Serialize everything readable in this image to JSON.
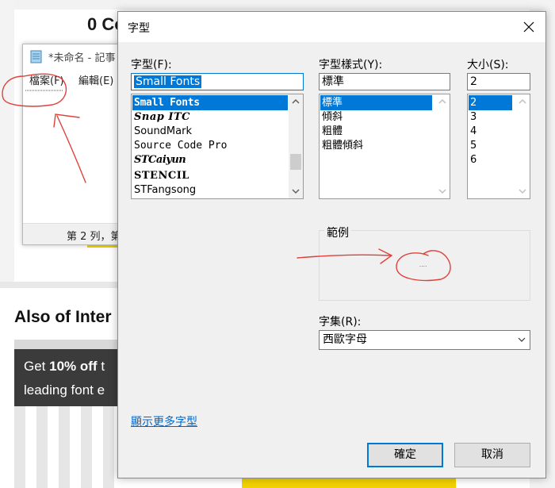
{
  "background": {
    "heading": "0 Co",
    "also_heading": "Also of Inter",
    "banner_line1_pre": "Get ",
    "banner_line1_bold": "10% off",
    "banner_line1_post": " t",
    "banner_line2": "leading font e"
  },
  "notepad": {
    "title": "*未命名 - 記事",
    "menu_file": "檔案(F)",
    "menu_edit": "編輯(E)",
    "status": "第 2 列，第"
  },
  "dialog": {
    "title": "字型",
    "font_label": "字型(F):",
    "font_value": "Small Fonts",
    "fonts": [
      "Small Fonts",
      "Snap ITC",
      "SoundMark",
      "Source Code Pro",
      "STCaiyun",
      "STENCIL",
      "STFangsong"
    ],
    "style_label": "字型樣式(Y):",
    "style_value": "標準",
    "styles": [
      "標準",
      "傾斜",
      "粗體",
      "粗體傾斜"
    ],
    "size_label": "大小(S):",
    "size_value": "2",
    "sizes": [
      "2",
      "3",
      "4",
      "5",
      "6"
    ],
    "sample_label": "範例",
    "sample_text": "....",
    "charset_label": "字集(R):",
    "charset_value": "西歐字母",
    "more_fonts_link": "顯示更多字型",
    "ok_label": "確定",
    "cancel_label": "取消"
  },
  "colors": {
    "selection": "#0078d7",
    "annotation": "#e0403a"
  }
}
